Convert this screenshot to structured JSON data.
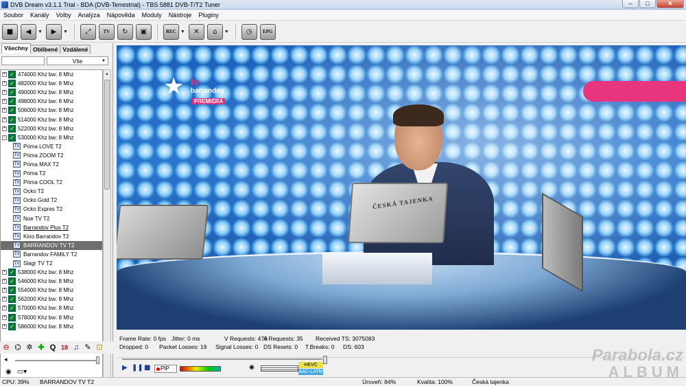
{
  "window": {
    "title": "DVB Dream v3.1.1 Trial - BDA (DVB-Terrestrial) - TBS 5881 DVB-T/T2 Tuner",
    "minimize": "–",
    "maximize": "□",
    "close": "✕"
  },
  "menu": [
    "Soubor",
    "Kanály",
    "Volby",
    "Analýza",
    "Nápověda",
    "Moduly",
    "Nástroje",
    "Pluginy"
  ],
  "toolbar": {
    "rec": "REC",
    "tv": "TV",
    "epg": "EPG"
  },
  "tabs": [
    "Všechny",
    "Oblíbené",
    "Vzdálené"
  ],
  "filter": {
    "value": "Vše"
  },
  "tree": [
    {
      "type": "freq",
      "label": "474000 Khz  bw: 8 Mhz",
      "expanded": false
    },
    {
      "type": "freq",
      "label": "482000 Khz  bw: 8 Mhz",
      "expanded": false
    },
    {
      "type": "freq",
      "label": "490000 Khz  bw: 8 Mhz",
      "expanded": false
    },
    {
      "type": "freq",
      "label": "498000 Khz  bw: 8 Mhz",
      "expanded": false
    },
    {
      "type": "freq",
      "label": "506000 Khz  bw: 8 Mhz",
      "expanded": false
    },
    {
      "type": "freq",
      "label": "514000 Khz  bw: 8 Mhz",
      "expanded": false
    },
    {
      "type": "freq",
      "label": "522000 Khz  bw: 8 Mhz",
      "expanded": false
    },
    {
      "type": "freq",
      "label": "530000 Khz  bw: 8 Mhz",
      "expanded": true
    },
    {
      "type": "chan",
      "label": "Prima LOVE T2"
    },
    {
      "type": "chan",
      "label": "Prima ZOOM T2"
    },
    {
      "type": "chan",
      "label": "Prima MAX T2"
    },
    {
      "type": "chan",
      "label": "Prima T2"
    },
    {
      "type": "chan",
      "label": "Prima COOL T2"
    },
    {
      "type": "chan",
      "label": "Ocko T2"
    },
    {
      "type": "chan",
      "label": "Ocko Gold T2"
    },
    {
      "type": "chan",
      "label": "Ocko Expres T2"
    },
    {
      "type": "chan",
      "label": "Noe TV T2"
    },
    {
      "type": "chan",
      "label": "Barrandov Plus T2",
      "underline": true
    },
    {
      "type": "chan",
      "label": "Kino Barrandov T2"
    },
    {
      "type": "chan",
      "label": "BARRANDOV TV T2",
      "selected": true
    },
    {
      "type": "chan",
      "label": "Barrandov FAMILY T2"
    },
    {
      "type": "chan",
      "label": "Slagr TV T2"
    },
    {
      "type": "freq",
      "label": "538000 Khz  bw: 8 Mhz",
      "expanded": false
    },
    {
      "type": "freq",
      "label": "546000 Khz  bw: 8 Mhz",
      "expanded": false
    },
    {
      "type": "freq",
      "label": "554000 Khz  bw: 8 Mhz",
      "expanded": false
    },
    {
      "type": "freq",
      "label": "562000 Khz  bw: 8 Mhz",
      "expanded": false
    },
    {
      "type": "freq",
      "label": "570000 Khz  bw: 8 Mhz",
      "expanded": false
    },
    {
      "type": "freq",
      "label": "578000 Khz  bw: 8 Mhz",
      "expanded": false
    },
    {
      "type": "freq",
      "label": "586000 Khz  bw: 8 Mhz",
      "expanded": false
    }
  ],
  "channel_icon_text": "TV",
  "video": {
    "logo_tv": "tv",
    "logo_name": "barrandov",
    "logo_sub": "PREMIÉRA",
    "laptop_label": "ČESKÁ TAJENKA"
  },
  "stats": {
    "frame_rate": "Frame Rate: 0 fps",
    "jitter": "Jitter: 0 ms",
    "v_requests": "V Requests: 476",
    "a_requests": "A Requests: 35",
    "received_ts": "Received TS: 3075083",
    "dropped": "Dropped: 0",
    "packet_losses": "Packet Losses: 19",
    "signal_losses": "Signal Losses: 0",
    "ds_resets": "DS Resets: 0",
    "t_breaks": "T.Breaks: 0",
    "ds": "DS: 603"
  },
  "controls": {
    "pip": "PIP",
    "video_codec": "HEVC",
    "audio_codec": "AAC-LATM"
  },
  "watermark": {
    "line1": "Parabola.cz",
    "line2": "ALBUM"
  },
  "status": {
    "cpu": "CPU: 39%",
    "channel": "BARRANDOV TV T2",
    "level": "Úroveň: 84%",
    "quality": "Kvalita: 100%",
    "program": "Česká tajenka"
  }
}
